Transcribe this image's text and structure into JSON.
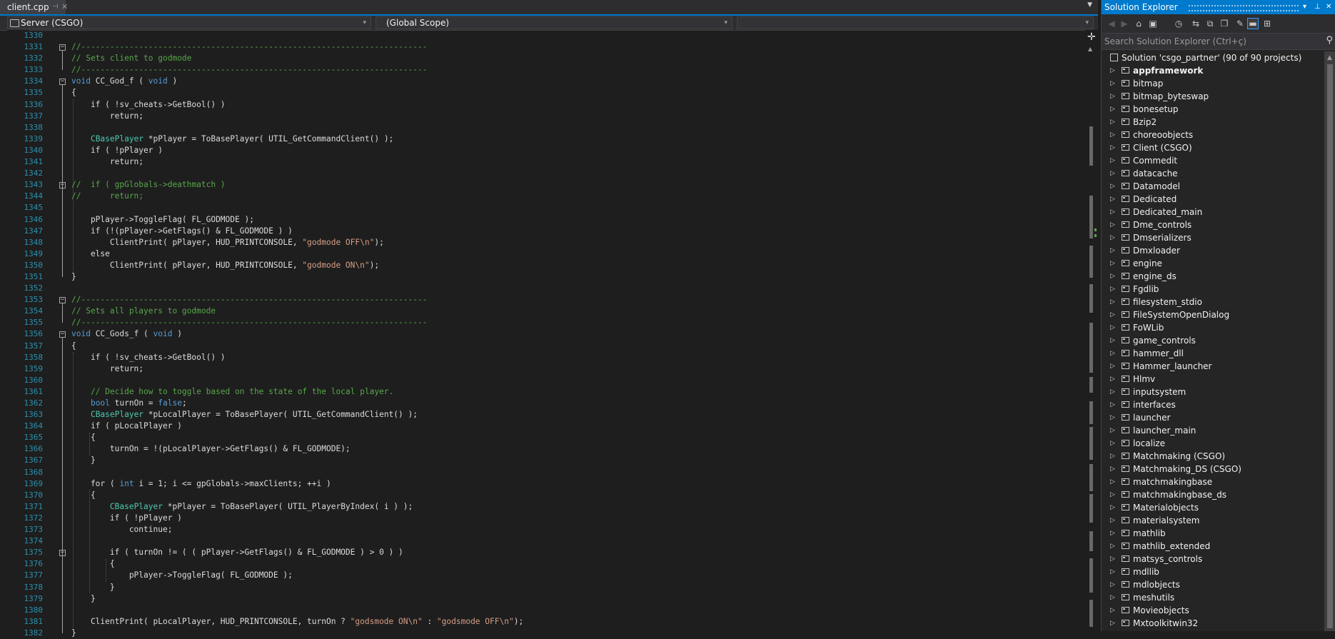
{
  "editor": {
    "tab": {
      "title": "client.cpp",
      "pin_icon": "pin-icon",
      "close_icon": "close-icon"
    },
    "nav": {
      "project": "Server (CSGO)",
      "scope": "(Global Scope)",
      "member": ""
    },
    "line_numbers": [
      "1330",
      "1331",
      "1332",
      "1333",
      "1334",
      "1335",
      "1336",
      "1337",
      "1338",
      "1339",
      "1340",
      "1341",
      "1342",
      "1343",
      "1344",
      "1345",
      "1346",
      "1347",
      "1348",
      "1349",
      "1350",
      "1351",
      "1352",
      "1353",
      "1354",
      "1355",
      "1356",
      "1357",
      "1358",
      "1359",
      "1360",
      "1361",
      "1362",
      "1363",
      "1364",
      "1365",
      "1366",
      "1367",
      "1368",
      "1369",
      "1370",
      "1371",
      "1372",
      "1373",
      "1374",
      "1375",
      "1376",
      "1377",
      "1378",
      "1379",
      "1380",
      "1381",
      "1382"
    ],
    "code_lines": [
      [],
      [
        {
          "t": "//------------------------------------------------------------------------",
          "c": "cm"
        }
      ],
      [
        {
          "t": "// Sets client to godmode",
          "c": "cm"
        }
      ],
      [
        {
          "t": "//------------------------------------------------------------------------",
          "c": "cm"
        }
      ],
      [
        {
          "t": "void",
          "c": "kw"
        },
        {
          "t": " CC_God_f ( "
        },
        {
          "t": "void",
          "c": "kw"
        },
        {
          "t": " )"
        }
      ],
      [
        {
          "t": "{"
        }
      ],
      [
        {
          "t": "    if ( !sv_cheats->GetBool() )"
        }
      ],
      [
        {
          "t": "        return;"
        }
      ],
      [],
      [
        {
          "t": "    "
        },
        {
          "t": "CBasePlayer",
          "c": "ty"
        },
        {
          "t": " *pPlayer = ToBasePlayer( UTIL_GetCommandClient() );"
        }
      ],
      [
        {
          "t": "    if ( !pPlayer )"
        }
      ],
      [
        {
          "t": "        return;"
        }
      ],
      [],
      [
        {
          "t": "//  if ( gpGlobals->deathmatch )",
          "c": "cm"
        }
      ],
      [
        {
          "t": "//      return;",
          "c": "cm"
        }
      ],
      [],
      [
        {
          "t": "    pPlayer->ToggleFlag( FL_GODMODE );"
        }
      ],
      [
        {
          "t": "    if (!(pPlayer->GetFlags() & FL_GODMODE ) )"
        }
      ],
      [
        {
          "t": "        ClientPrint( pPlayer, HUD_PRINTCONSOLE, "
        },
        {
          "t": "\"godmode OFF\\n\"",
          "c": "str"
        },
        {
          "t": ");"
        }
      ],
      [
        {
          "t": "    else"
        }
      ],
      [
        {
          "t": "        ClientPrint( pPlayer, HUD_PRINTCONSOLE, "
        },
        {
          "t": "\"godmode ON\\n\"",
          "c": "str"
        },
        {
          "t": ");"
        }
      ],
      [
        {
          "t": "}"
        }
      ],
      [],
      [
        {
          "t": "//------------------------------------------------------------------------",
          "c": "cm"
        }
      ],
      [
        {
          "t": "// Sets all players to godmode",
          "c": "cm"
        }
      ],
      [
        {
          "t": "//------------------------------------------------------------------------",
          "c": "cm"
        }
      ],
      [
        {
          "t": "void",
          "c": "kw"
        },
        {
          "t": " CC_Gods_f ( "
        },
        {
          "t": "void",
          "c": "kw"
        },
        {
          "t": " )"
        }
      ],
      [
        {
          "t": "{"
        }
      ],
      [
        {
          "t": "    if ( !sv_cheats->GetBool() )"
        }
      ],
      [
        {
          "t": "        return;"
        }
      ],
      [],
      [
        {
          "t": "    // Decide how to toggle based on the state of the local player.",
          "c": "cm"
        }
      ],
      [
        {
          "t": "    "
        },
        {
          "t": "bool",
          "c": "kw"
        },
        {
          "t": " turnOn = "
        },
        {
          "t": "false",
          "c": "kw"
        },
        {
          "t": ";"
        }
      ],
      [
        {
          "t": "    "
        },
        {
          "t": "CBasePlayer",
          "c": "ty"
        },
        {
          "t": " *pLocalPlayer = ToBasePlayer( UTIL_GetCommandClient() );"
        }
      ],
      [
        {
          "t": "    if ( pLocalPlayer )"
        }
      ],
      [
        {
          "t": "    {"
        }
      ],
      [
        {
          "t": "        turnOn = !(pLocalPlayer->GetFlags() & FL_GODMODE);"
        }
      ],
      [
        {
          "t": "    }"
        }
      ],
      [],
      [
        {
          "t": "    for ( "
        },
        {
          "t": "int",
          "c": "kw"
        },
        {
          "t": " i = 1; i <= gpGlobals->maxClients; ++i )"
        }
      ],
      [
        {
          "t": "    {"
        }
      ],
      [
        {
          "t": "        "
        },
        {
          "t": "CBasePlayer",
          "c": "ty"
        },
        {
          "t": " *pPlayer = ToBasePlayer( UTIL_PlayerByIndex( i ) );"
        }
      ],
      [
        {
          "t": "        if ( !pPlayer )"
        }
      ],
      [
        {
          "t": "            continue;"
        }
      ],
      [],
      [
        {
          "t": "        if ( turnOn != ( ( pPlayer->GetFlags() & FL_GODMODE ) > 0 ) )"
        }
      ],
      [
        {
          "t": "        {"
        }
      ],
      [
        {
          "t": "            pPlayer->ToggleFlag( FL_GODMODE );"
        }
      ],
      [
        {
          "t": "        }"
        }
      ],
      [
        {
          "t": "    }"
        }
      ],
      [],
      [
        {
          "t": "    ClientPrint( pLocalPlayer, HUD_PRINTCONSOLE, turnOn ? "
        },
        {
          "t": "\"godsmode ON\\n\"",
          "c": "str"
        },
        {
          "t": " : "
        },
        {
          "t": "\"godsmode OFF\\n\"",
          "c": "str"
        },
        {
          "t": ");"
        }
      ],
      [
        {
          "t": "}"
        }
      ]
    ]
  },
  "solution_explorer": {
    "title": "Solution Explorer",
    "search_placeholder": "Search Solution Explorer (Ctrl+ç)",
    "solution_label": "Solution 'csgo_partner' (90 of 90 projects)",
    "projects": [
      "appframework",
      "bitmap",
      "bitmap_byteswap",
      "bonesetup",
      "Bzip2",
      "choreoobjects",
      "Client (CSGO)",
      "Commedit",
      "datacache",
      "Datamodel",
      "Dedicated",
      "Dedicated_main",
      "Dme_controls",
      "Dmserializers",
      "Dmxloader",
      "engine",
      "engine_ds",
      "Fgdlib",
      "filesystem_stdio",
      "FileSystemOpenDialog",
      "FoWLib",
      "game_controls",
      "hammer_dll",
      "Hammer_launcher",
      "Hlmv",
      "inputsystem",
      "interfaces",
      "launcher",
      "launcher_main",
      "localize",
      "Matchmaking (CSGO)",
      "Matchmaking_DS (CSGO)",
      "matchmakingbase",
      "matchmakingbase_ds",
      "Materialobjects",
      "materialsystem",
      "mathlib",
      "mathlib_extended",
      "matsys_controls",
      "mdllib",
      "mdlobjects",
      "meshutils",
      "Movieobjects",
      "Mxtoolkitwin32"
    ],
    "bold_project": "appframework",
    "toolbar_icons": [
      "back-icon",
      "forward-icon",
      "home-icon",
      "switch-views-icon",
      "pending-changes-icon",
      "sync-icon",
      "collapse-all-icon",
      "show-all-files-icon",
      "properties-icon",
      "preview-icon",
      "class-view-icon"
    ]
  },
  "colors": {
    "accent": "#007acc",
    "comment": "#57a64a",
    "keyword": "#569cd6",
    "string": "#d69d85",
    "type": "#4ec9b0",
    "line_number": "#2b91af"
  }
}
